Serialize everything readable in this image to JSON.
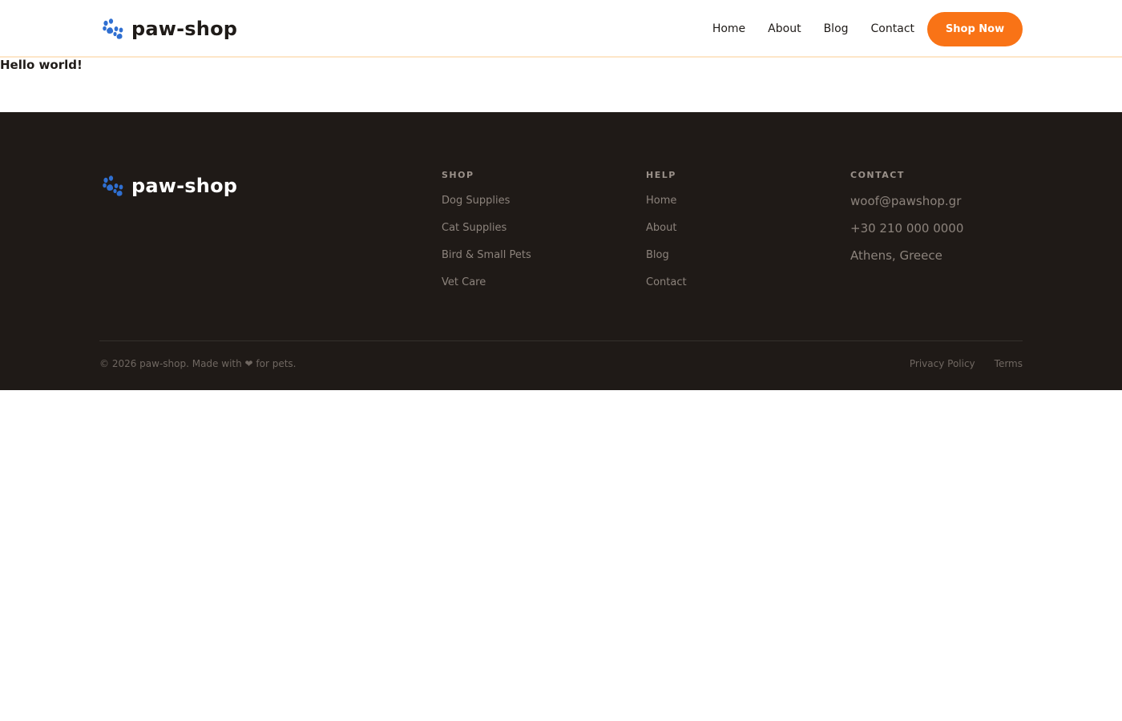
{
  "header": {
    "brand": "paw-shop",
    "nav": [
      "Home",
      "About",
      "Blog",
      "Contact"
    ],
    "cta_label": "Shop Now"
  },
  "main": {
    "text": "Hello world!"
  },
  "footer": {
    "brand": "paw-shop",
    "columns": {
      "shop": {
        "title": "SHOP",
        "items": [
          "Dog Supplies",
          "Cat Supplies",
          "Bird & Small Pets",
          "Vet Care"
        ]
      },
      "help": {
        "title": "HELP",
        "items": [
          "Home",
          "About",
          "Blog",
          "Contact"
        ]
      },
      "contact": {
        "title": "CONTACT",
        "items": [
          "woof@pawshop.gr",
          "+30 210 000 0000",
          "Athens, Greece"
        ]
      }
    },
    "copyright": "© 2026 paw-shop. Made with ❤ for pets.",
    "legal": [
      "Privacy Policy",
      "Terms"
    ]
  },
  "colors": {
    "accent": "#f97316",
    "paw_icon": "#2f6fd1",
    "footer_bg": "#1f1a17"
  },
  "icons": {
    "brand_icon": "paw-icon"
  }
}
